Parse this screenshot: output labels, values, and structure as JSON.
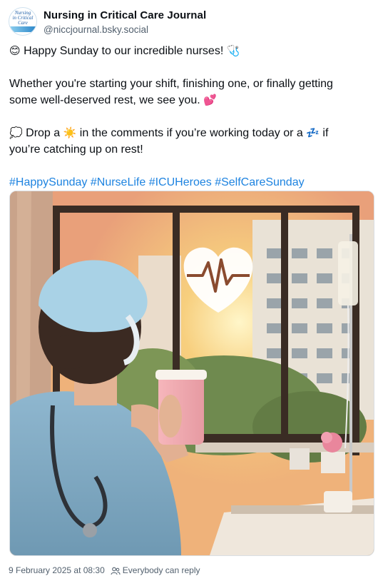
{
  "author": {
    "display_name": "Nursing in Critical Care Journal",
    "handle": "@niccjournal.bsky.social",
    "avatar_text": [
      "Nursing",
      "in Critical",
      "Care"
    ]
  },
  "post": {
    "line1": "Happy Sunday to our incredible nurses!",
    "line2": "Whether you're starting your shift, finishing one, or finally getting",
    "line3": "some well-deserved rest, we see you.",
    "line4_part1": "Drop a",
    "line4_part2": "in the comments if you’re working today or a",
    "line4_part3": "if",
    "line5": "you’re catching up on rest!",
    "hashtags": [
      "#HappySunday",
      "#NurseLife",
      "#ICUHeroes",
      "#SelfCareSunday"
    ]
  },
  "emojis": {
    "smile": "😊",
    "stethoscope": "🩺",
    "hearts": "💕",
    "speech": "💭",
    "sun": "☀️",
    "sleep": "💤"
  },
  "image": {
    "description_icon": "heart-heartbeat-icon"
  },
  "footer": {
    "timestamp": "9 February 2025 at 08:30",
    "reply_setting": "Everybody can reply"
  },
  "colors": {
    "accent": "#1d83e0",
    "muted": "#52606e"
  }
}
